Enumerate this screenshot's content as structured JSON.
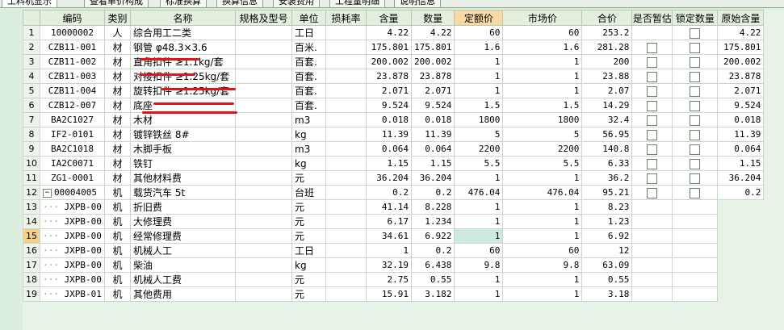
{
  "tabs": [
    {
      "label": "工料机显示",
      "active": true
    },
    {
      "label": "查看单价构成",
      "active": false
    },
    {
      "label": "标准换算",
      "active": false
    },
    {
      "label": "换算信息",
      "active": false
    },
    {
      "label": "安装费用",
      "active": false
    },
    {
      "label": "工程量明细",
      "active": false
    },
    {
      "label": "说明信息",
      "active": false
    }
  ],
  "columns": {
    "idx": "",
    "code": "编码",
    "cat": "类别",
    "name": "名称",
    "spec": "规格及型号",
    "unit": "单位",
    "loss": "损耗率",
    "content": "含量",
    "qty": "数量",
    "quota_price": "定额价",
    "market_price": "市场价",
    "total": "合价",
    "is_est": "是否暂估",
    "lock_qty": "锁定数量",
    "orig_content": "原始含量"
  },
  "rows": [
    {
      "idx": "1",
      "code": "10000002",
      "cat": "人",
      "name": "综合用工二类",
      "unit": "工日",
      "content": "4.22",
      "qty": "4.22",
      "quota_price": "60",
      "market_price": "60",
      "total": "253.2",
      "est": false,
      "lock": true,
      "orig": "4.22"
    },
    {
      "idx": "2",
      "code": "CZB11-001",
      "cat": "材",
      "name": "钢管 φ48.3×3.6",
      "unit": "百米.",
      "content": "175.801",
      "qty": "175.801",
      "quota_price": "1.6",
      "market_price": "1.6",
      "total": "281.28",
      "est": true,
      "lock": true,
      "orig": "175.801"
    },
    {
      "idx": "3",
      "code": "CZB11-002",
      "cat": "材",
      "name": "直角扣件 ≥1.1kg/套",
      "unit": "百套.",
      "content": "200.002",
      "qty": "200.002",
      "quota_price": "1",
      "market_price": "1",
      "total": "200",
      "est": true,
      "lock": true,
      "orig": "200.002"
    },
    {
      "idx": "4",
      "code": "CZB11-003",
      "cat": "材",
      "name": "对接扣件 ≥1.25kg/套",
      "unit": "百套.",
      "content": "23.878",
      "qty": "23.878",
      "quota_price": "1",
      "market_price": "1",
      "total": "23.88",
      "est": true,
      "lock": true,
      "orig": "23.878"
    },
    {
      "idx": "5",
      "code": "CZB11-004",
      "cat": "材",
      "name": "旋转扣件 ≥1.25kg/套",
      "unit": "百套.",
      "content": "2.071",
      "qty": "2.071",
      "quota_price": "1",
      "market_price": "1",
      "total": "2.07",
      "est": true,
      "lock": true,
      "orig": "2.071"
    },
    {
      "idx": "6",
      "code": "CZB12-007",
      "cat": "材",
      "name": "底座",
      "unit": "百套.",
      "content": "9.524",
      "qty": "9.524",
      "quota_price": "1.5",
      "market_price": "1.5",
      "total": "14.29",
      "est": true,
      "lock": true,
      "orig": "9.524"
    },
    {
      "idx": "7",
      "code": "BA2C1027",
      "cat": "材",
      "name": "木材",
      "unit": "m3",
      "content": "0.018",
      "qty": "0.018",
      "quota_price": "1800",
      "market_price": "1800",
      "total": "32.4",
      "est": true,
      "lock": true,
      "orig": "0.018"
    },
    {
      "idx": "8",
      "code": "IF2-0101",
      "cat": "材",
      "name": "镀锌铁丝 8#",
      "unit": "kg",
      "content": "11.39",
      "qty": "11.39",
      "quota_price": "5",
      "market_price": "5",
      "total": "56.95",
      "est": true,
      "lock": true,
      "orig": "11.39"
    },
    {
      "idx": "9",
      "code": "BA2C1018",
      "cat": "材",
      "name": "木脚手板",
      "unit": "m3",
      "content": "0.064",
      "qty": "0.064",
      "quota_price": "2200",
      "market_price": "2200",
      "total": "140.8",
      "est": true,
      "lock": true,
      "orig": "0.064"
    },
    {
      "idx": "10",
      "code": "IA2C0071",
      "cat": "材",
      "name": "铁钉",
      "unit": "kg",
      "content": "1.15",
      "qty": "1.15",
      "quota_price": "5.5",
      "market_price": "5.5",
      "total": "6.33",
      "est": true,
      "lock": true,
      "orig": "1.15"
    },
    {
      "idx": "11",
      "code": "ZG1-0001",
      "cat": "材",
      "name": "其他材料费",
      "unit": "元",
      "content": "36.204",
      "qty": "36.204",
      "quota_price": "1",
      "market_price": "1",
      "total": "36.2",
      "est": true,
      "lock": true,
      "orig": "36.204"
    },
    {
      "idx": "12",
      "code": "00004005",
      "cat": "机",
      "name": "载货汽车 5t",
      "unit": "台班",
      "content": "0.2",
      "qty": "0.2",
      "quota_price": "476.04",
      "market_price": "476.04",
      "total": "95.21",
      "est": true,
      "lock": true,
      "orig": "0.2",
      "parent": true
    },
    {
      "idx": "13",
      "code": "JXPB-00",
      "cat": "机",
      "name": "折旧费",
      "unit": "元",
      "content": "41.14",
      "qty": "8.228",
      "quota_price": "1",
      "market_price": "1",
      "total": "8.23",
      "child": true
    },
    {
      "idx": "14",
      "code": "JXPB-00",
      "cat": "机",
      "name": "大修理费",
      "unit": "元",
      "content": "6.17",
      "qty": "1.234",
      "quota_price": "1",
      "market_price": "1",
      "total": "1.23",
      "child": true
    },
    {
      "idx": "15",
      "code": "JXPB-00",
      "cat": "机",
      "name": "经常修理费",
      "unit": "元",
      "content": "34.61",
      "qty": "6.922",
      "quota_price": "1",
      "market_price": "1",
      "total": "6.92",
      "child": true,
      "selected": true
    },
    {
      "idx": "16",
      "code": "JXPB-00",
      "cat": "机",
      "name": "机械人工",
      "unit": "工日",
      "content": "1",
      "qty": "0.2",
      "quota_price": "60",
      "market_price": "60",
      "total": "12",
      "child": true
    },
    {
      "idx": "17",
      "code": "JXPB-00",
      "cat": "机",
      "name": "柴油",
      "unit": "kg",
      "content": "32.19",
      "qty": "6.438",
      "quota_price": "9.8",
      "market_price": "9.8",
      "total": "63.09",
      "child": true
    },
    {
      "idx": "18",
      "code": "JXPB-00",
      "cat": "机",
      "name": "机械人工费",
      "unit": "元",
      "content": "2.75",
      "qty": "0.55",
      "quota_price": "1",
      "market_price": "1",
      "total": "0.55",
      "child": true
    },
    {
      "idx": "19",
      "code": "JXPB-01",
      "cat": "机",
      "name": "其他费用",
      "unit": "元",
      "content": "15.91",
      "qty": "3.182",
      "quota_price": "1",
      "market_price": "1",
      "total": "3.18",
      "child": true
    }
  ],
  "annotation_color": "#e0141a"
}
